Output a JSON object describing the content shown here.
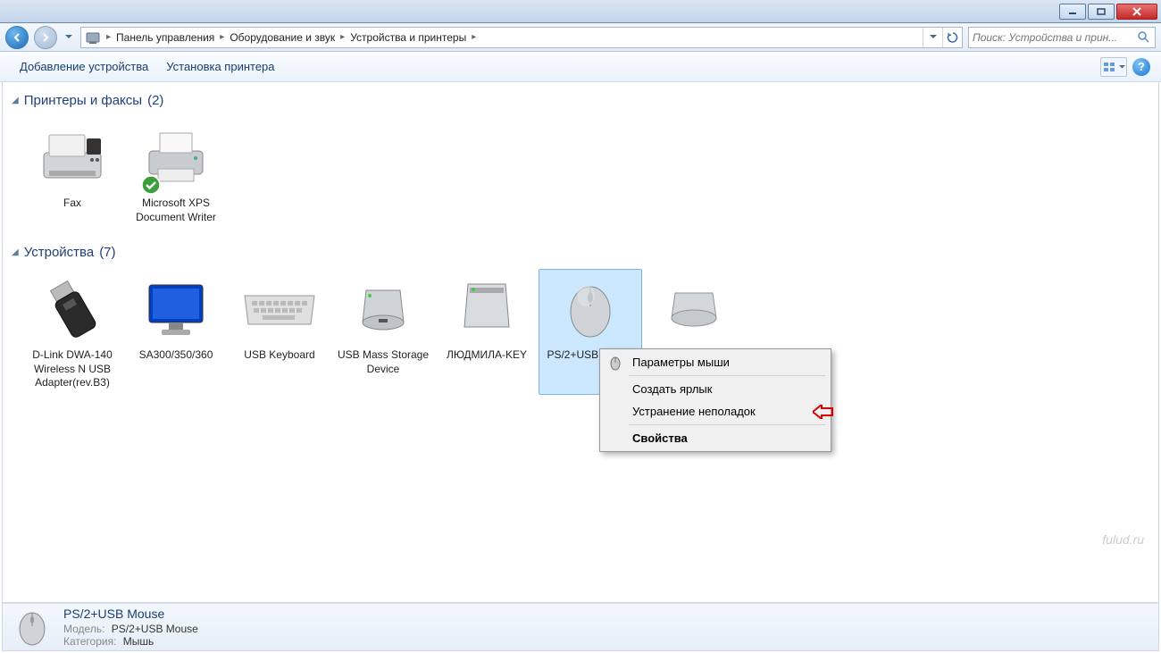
{
  "breadcrumbs": [
    "Панель управления",
    "Оборудование и звук",
    "Устройства и принтеры"
  ],
  "search": {
    "placeholder": "Поиск: Устройства и прин..."
  },
  "toolbar": {
    "add_device": "Добавление устройства",
    "add_printer": "Установка принтера"
  },
  "groups": [
    {
      "title": "Принтеры и факсы",
      "count": "(2)",
      "items": [
        {
          "label": "Fax",
          "icon": "fax"
        },
        {
          "label": "Microsoft XPS Document Writer",
          "icon": "printer",
          "default": true
        }
      ]
    },
    {
      "title": "Устройства",
      "count": "(7)",
      "items": [
        {
          "label": "D-Link DWA-140 Wireless N USB Adapter(rev.B3)",
          "icon": "usb-adapter"
        },
        {
          "label": "SA300/350/360",
          "icon": "monitor"
        },
        {
          "label": "USB Keyboard",
          "icon": "keyboard"
        },
        {
          "label": "USB Mass Storage Device",
          "icon": "hdd"
        },
        {
          "label": "ЛЮДМИЛА-KEY",
          "icon": "drive"
        },
        {
          "label": "PS/2+USB Mouse",
          "icon": "mouse",
          "selected": true
        },
        {
          "label": "",
          "icon": "hdd2"
        }
      ]
    }
  ],
  "context_menu": {
    "items": [
      {
        "label": "Параметры мыши",
        "icon": true
      },
      {
        "label": "Создать ярлык"
      },
      {
        "label": "Устранение неполадок",
        "arrow": true
      },
      {
        "label": "Свойства",
        "bold": true
      }
    ]
  },
  "details": {
    "title": "PS/2+USB Mouse",
    "model_label": "Модель:",
    "model_value": "PS/2+USB Mouse",
    "category_label": "Категория:",
    "category_value": "Мышь"
  },
  "watermark": "fulud.ru"
}
